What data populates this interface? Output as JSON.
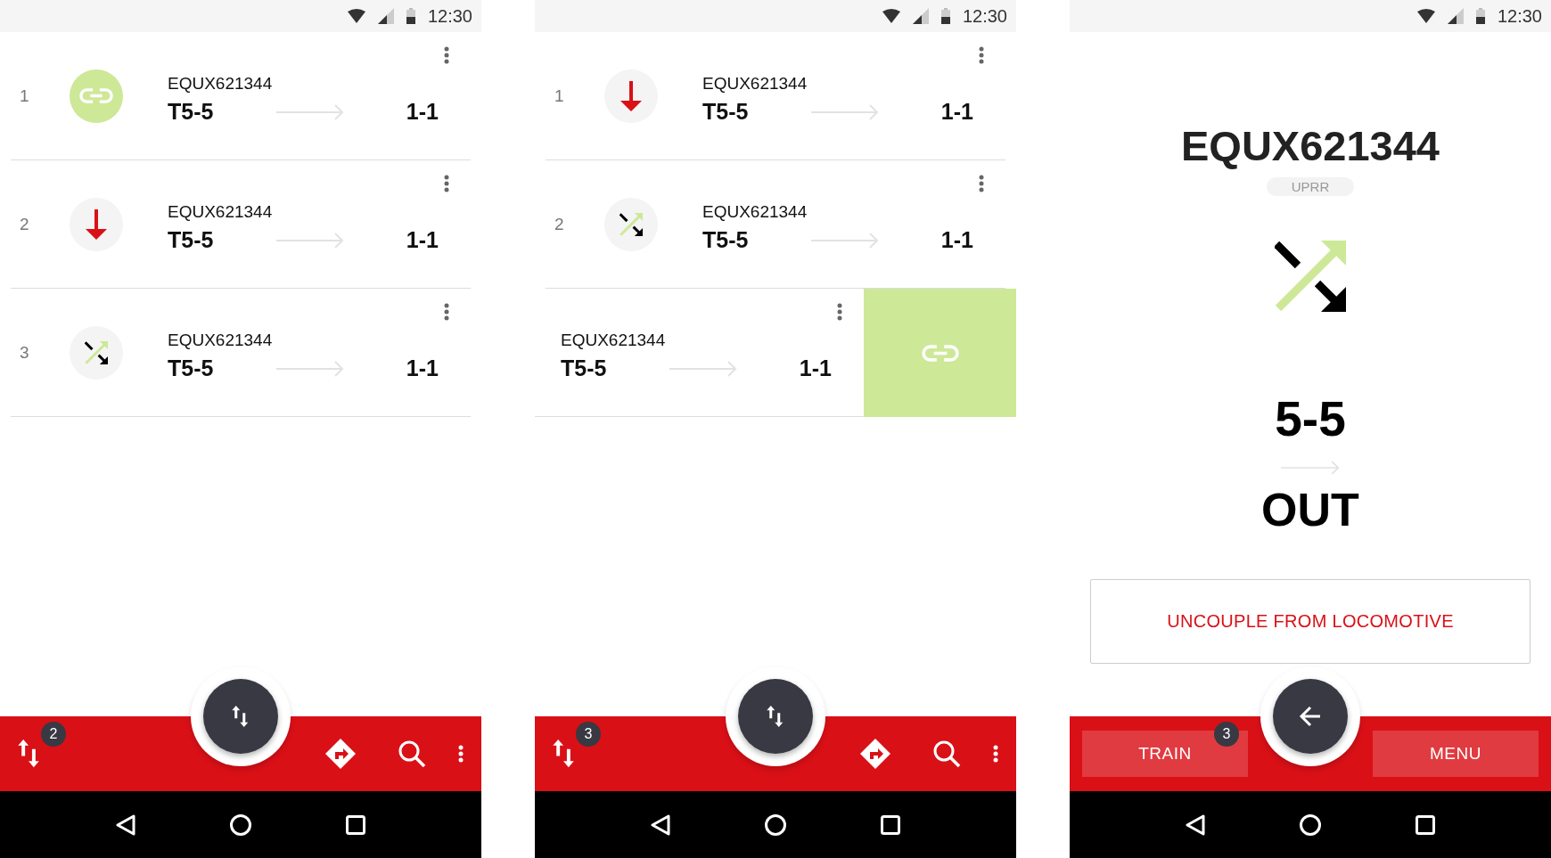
{
  "screens": [
    {
      "kind": "list",
      "status_bar": {
        "time": "12:30"
      },
      "rows": [
        {
          "swiped": false,
          "number": "1",
          "kind": "coupled",
          "container": "EQUX621344",
          "from": "T5-5",
          "to": "1-1"
        },
        {
          "swiped": false,
          "number": "2",
          "kind": "drop",
          "container": "EQUX621344",
          "from": "T5-5",
          "to": "1-1"
        },
        {
          "swiped": false,
          "number": "3",
          "kind": "switch",
          "container": "EQUX621344",
          "from": "T5-5",
          "to": "1-1"
        }
      ],
      "bottom_bar": {
        "kind": "icons",
        "badge": "2"
      }
    },
    {
      "kind": "list",
      "status_bar": {
        "time": "12:30"
      },
      "rows": [
        {
          "swiped": false,
          "number": "1",
          "kind": "drop",
          "container": "EQUX621344",
          "from": "T5-5",
          "to": "1-1"
        },
        {
          "swiped": false,
          "number": "2",
          "kind": "switch",
          "container": "EQUX621344",
          "from": "T5-5",
          "to": "1-1"
        },
        {
          "swiped": true,
          "kind": "coupled",
          "container": "EQUX621344",
          "from": "T5-5",
          "to": "1-1"
        }
      ],
      "bottom_bar": {
        "kind": "icons",
        "badge": "3"
      }
    },
    {
      "kind": "detail",
      "status_bar": {
        "time": "12:30"
      },
      "title": "EQUX621344",
      "owner": "UPRR",
      "move": {
        "kind": "switch"
      },
      "from": "5-5",
      "to": "OUT",
      "action": "UNCOUPLE FROM LOCOMOTIVE",
      "bottom_bar": {
        "kind": "buttons",
        "buttons": [
          {
            "label": "TRAIN",
            "badge": "3"
          },
          {
            "label": "MENU"
          }
        ]
      }
    }
  ]
}
